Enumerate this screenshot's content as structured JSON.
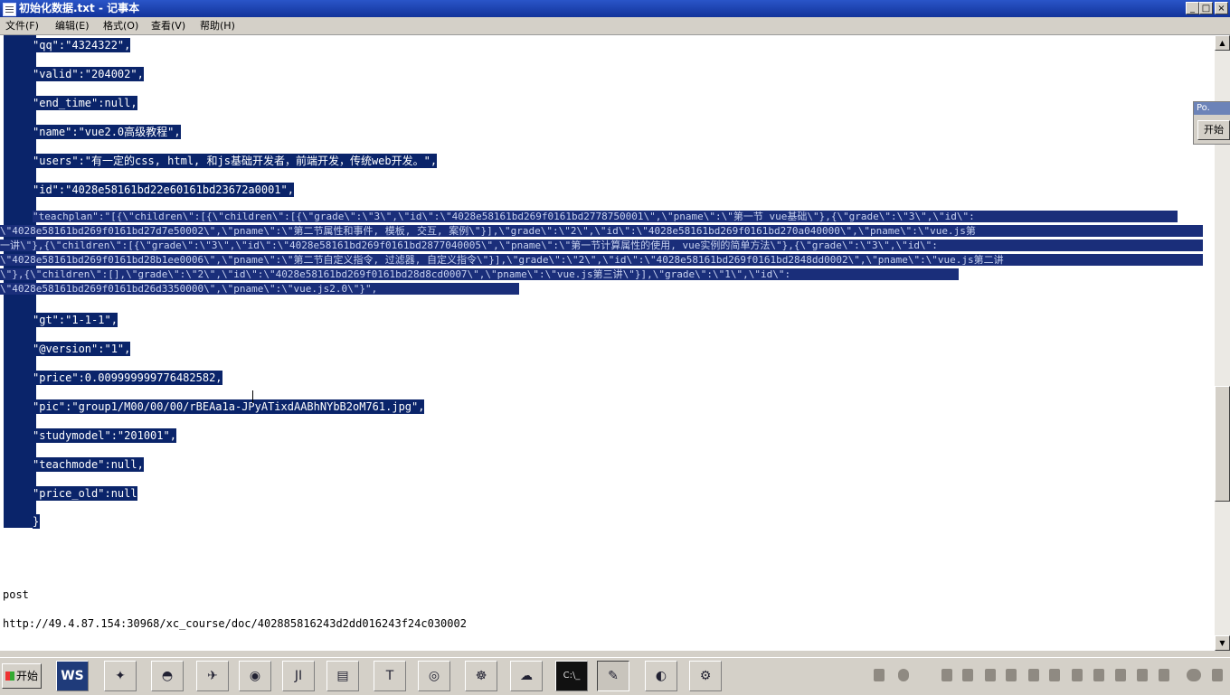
{
  "window": {
    "title": "初始化数据.txt - 记事本",
    "min": "_",
    "max": "□",
    "close": "×"
  },
  "menu": [
    "文件(F)",
    "编辑(E)",
    "格式(O)",
    "查看(V)",
    "帮助(H)"
  ],
  "json_lines": [
    "\"qq\":\"4324322\",",
    "\"valid\":\"204002\",",
    "\"end_time\":null,",
    "\"name\":\"vue2.0高级教程\",",
    "\"users\":\"有一定的css, html, 和js基础开发者，前端开发，传统web开发。\",",
    "\"id\":\"4028e58161bd22e60161bd23672a0001\","
  ],
  "teachplan_lines": [
    "\"teachplan\":\"[{\\\"children\\\":[{\\\"children\\\":[{\\\"grade\\\":\\\"3\\\",\\\"id\\\":\\\"4028e58161bd269f0161bd2778750001\\\",\\\"pname\\\":\\\"第一节 vue基础\\\"},{\\\"grade\\\":\\\"3\\\",\\\"id\\\":",
    "\\\"4028e58161bd269f0161bd27d7e50002\\\",\\\"pname\\\":\\\"第二节属性和事件, 模板, 交互, 案例\\\"}],\\\"grade\\\":\\\"2\\\",\\\"id\\\":\\\"4028e58161bd269f0161bd270a040000\\\",\\\"pname\\\":\\\"vue.js第",
    "一讲\\\"},{\\\"children\\\":[{\\\"grade\\\":\\\"3\\\",\\\"id\\\":\\\"4028e58161bd269f0161bd2877040005\\\",\\\"pname\\\":\\\"第一节计算属性的使用, vue实例的简单方法\\\"},{\\\"grade\\\":\\\"3\\\",\\\"id\\\":",
    "\\\"4028e58161bd269f0161bd28b1ee0006\\\",\\\"pname\\\":\\\"第二节自定义指令, 过滤器, 自定义指令\\\"}],\\\"grade\\\":\\\"2\\\",\\\"id\\\":\\\"4028e58161bd269f0161bd2848dd0002\\\",\\\"pname\\\":\\\"vue.js第二讲",
    "\\\"},{\\\"children\\\":[],\\\"grade\\\":\\\"2\\\",\\\"id\\\":\\\"4028e58161bd269f0161bd28d8cd0007\\\",\\\"pname\\\":\\\"vue.js第三讲\\\"}],\\\"grade\\\":\\\"1\\\",\\\"id\\\":",
    "\\\"4028e58161bd269f0161bd26d3350000\\\",\\\"pname\\\":\\\"vue.js2.0\\\"}\","
  ],
  "json_lines2": [
    "\"gt\":\"1-1-1\",",
    "\"@version\":\"1\",",
    "\"price\":0.009999999776482582,",
    "\"pic\":\"group1/M00/00/00/rBEAa1a-JPyATixdAABhNYbB2oM761.jpg\",",
    "\"studymodel\":\"201001\",",
    "\"teachmode\":null,",
    "\"price_old\":null",
    "}"
  ],
  "post_label": "post",
  "url": "http://49.4.87.154:30968/xc_course/doc/402885816243d2dd016243f24c030002",
  "floating_panel": {
    "title": "Po.",
    "button": "开始"
  },
  "taskbar": {
    "start": "开始",
    "apps": [
      "WS",
      "",
      "",
      "",
      "",
      "JI",
      "",
      "T",
      "",
      "",
      "",
      "C:\\_",
      "",
      "",
      ""
    ]
  },
  "colors": {
    "selection": "#0a246a",
    "titlebar": "#12339a",
    "chrome": "#d4d0c8"
  }
}
